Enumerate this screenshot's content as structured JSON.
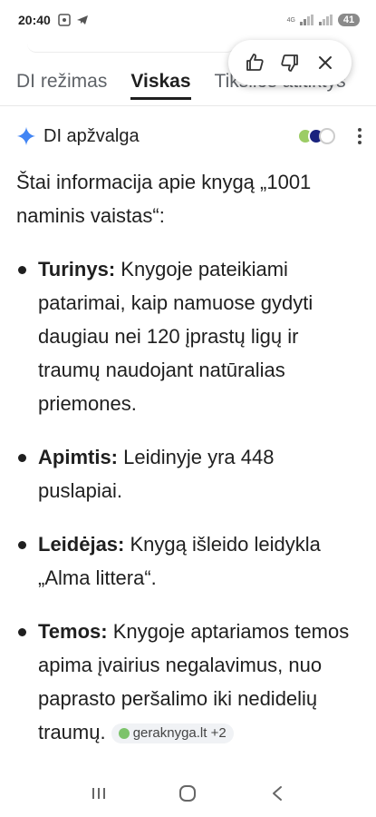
{
  "status_bar": {
    "time": "20:40",
    "network": "4G",
    "battery": "41"
  },
  "tabs": [
    {
      "label": "DI režimas",
      "active": false
    },
    {
      "label": "Viskas",
      "active": true
    },
    {
      "label": "Tikslios atitiktys",
      "active": false
    }
  ],
  "feedback": {
    "icons": [
      "thumbs-up-icon",
      "thumbs-down-icon",
      "close-icon"
    ]
  },
  "overview": {
    "title": "DI apžvalga"
  },
  "content": {
    "intro": "Štai informacija apie knygą „1001 naminis vaistas“:",
    "bullets": [
      {
        "label": "Turinys:",
        "text": " Knygoje pateikiami patarimai, kaip namuose gydyti daugiau nei 120 įprastų ligų ir traumų naudojant natūralias priemones."
      },
      {
        "label": "Apimtis:",
        "text": " Leidinyje yra 448 puslapiai."
      },
      {
        "label": "Leidėjas:",
        "text": " Knygą išleido leidykla „Alma littera“."
      },
      {
        "label": "Temos:",
        "text": " Knygoje aptariamos temos apima įvairius negalavimus, nuo paprasto peršalimo iki nedidelių traumų."
      }
    ],
    "source_chip": "geraknyga.lt +2"
  },
  "colors": {
    "accent": "#4285f4",
    "text": "#1f1f1f"
  }
}
